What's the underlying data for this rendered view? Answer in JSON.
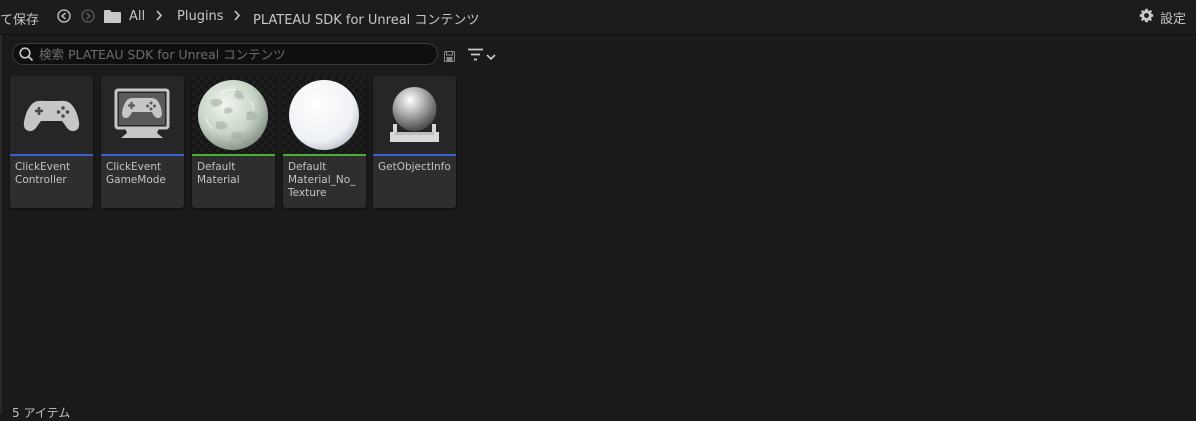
{
  "toolbar": {
    "save_all": "て保存",
    "breadcrumbs": [
      "All",
      "Plugins",
      "PLATEAU SDK for Unreal コンテンツ"
    ],
    "settings_label": "設定"
  },
  "search": {
    "placeholder": "検索 PLATEAU SDK for Unreal コンテンツ"
  },
  "assets": [
    {
      "label": "ClickEvent\nController",
      "type_color": "#3c5fcf",
      "icon": "gamepad-icon"
    },
    {
      "label": "ClickEvent\nGameMode",
      "type_color": "#3c5fcf",
      "icon": "gamemode-monitor-icon"
    },
    {
      "label": "Default\nMaterial",
      "type_color": "#4caf3a",
      "icon": "material-sphere-textured"
    },
    {
      "label": "Default\nMaterial_No_\nTexture",
      "type_color": "#4caf3a",
      "icon": "material-sphere-white"
    },
    {
      "label": "GetObjectInfo",
      "type_color": "#3c5fcf",
      "icon": "actor-sphere-icon"
    }
  ],
  "status": {
    "item_count": "5 アイテム"
  },
  "colors": {
    "blueprint": "#3c5fcf",
    "material": "#4caf3a"
  }
}
